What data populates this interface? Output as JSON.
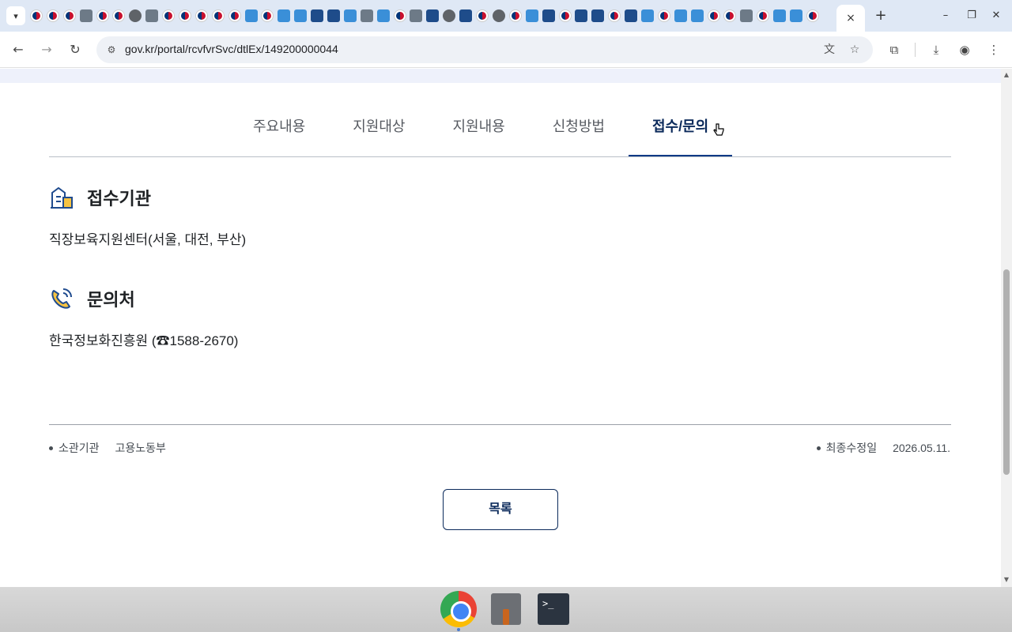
{
  "browser": {
    "url": "gov.kr/portal/rcvfvrSvc/dtlEx/149200000044",
    "favicons": [
      "gov",
      "gov",
      "gov",
      "gray",
      "gov",
      "gov",
      "globe",
      "gray",
      "gov",
      "gov",
      "gov",
      "gov",
      "gov",
      "blue",
      "gov",
      "blue",
      "blue",
      "navy",
      "navy",
      "blue",
      "gray",
      "blue",
      "gov",
      "gray",
      "navy",
      "globe",
      "navy",
      "gov",
      "globe",
      "gov",
      "blue",
      "navy",
      "gov",
      "navy",
      "navy",
      "gov",
      "navy",
      "blue",
      "gov",
      "blue",
      "blue",
      "gov",
      "gov",
      "gray",
      "gov",
      "blue",
      "blue",
      "gov"
    ],
    "icons": {
      "tab_search": "chevron-down-icon",
      "close_tab": "×",
      "new_tab": "+",
      "minimize": "–",
      "restore": "❐",
      "close_window": "✕",
      "back": "←",
      "forward": "→",
      "reload": "↻",
      "site_info": "⚙",
      "translate": "文",
      "bookmark": "☆",
      "extensions": "⧉",
      "downloads": "⤓",
      "profile": "◉",
      "menu": "⋮"
    }
  },
  "page": {
    "tabs": [
      {
        "label": "주요내용"
      },
      {
        "label": "지원대상"
      },
      {
        "label": "지원내용"
      },
      {
        "label": "신청방법"
      },
      {
        "label": "접수/문의"
      }
    ],
    "reception": {
      "title": "접수기관",
      "body": "직장보육지원센터(서울, 대전, 부산)"
    },
    "contact": {
      "title": "문의처",
      "body": "한국정보화진흥원 (☎1588-2670)"
    },
    "meta": {
      "agency_label": "소관기관",
      "agency_value": "고용노동부",
      "updated_label": "최종수정일",
      "updated_value": "2026.05.11."
    },
    "list_button": "목록"
  },
  "dock": {
    "terminal_prompt": ">_"
  }
}
